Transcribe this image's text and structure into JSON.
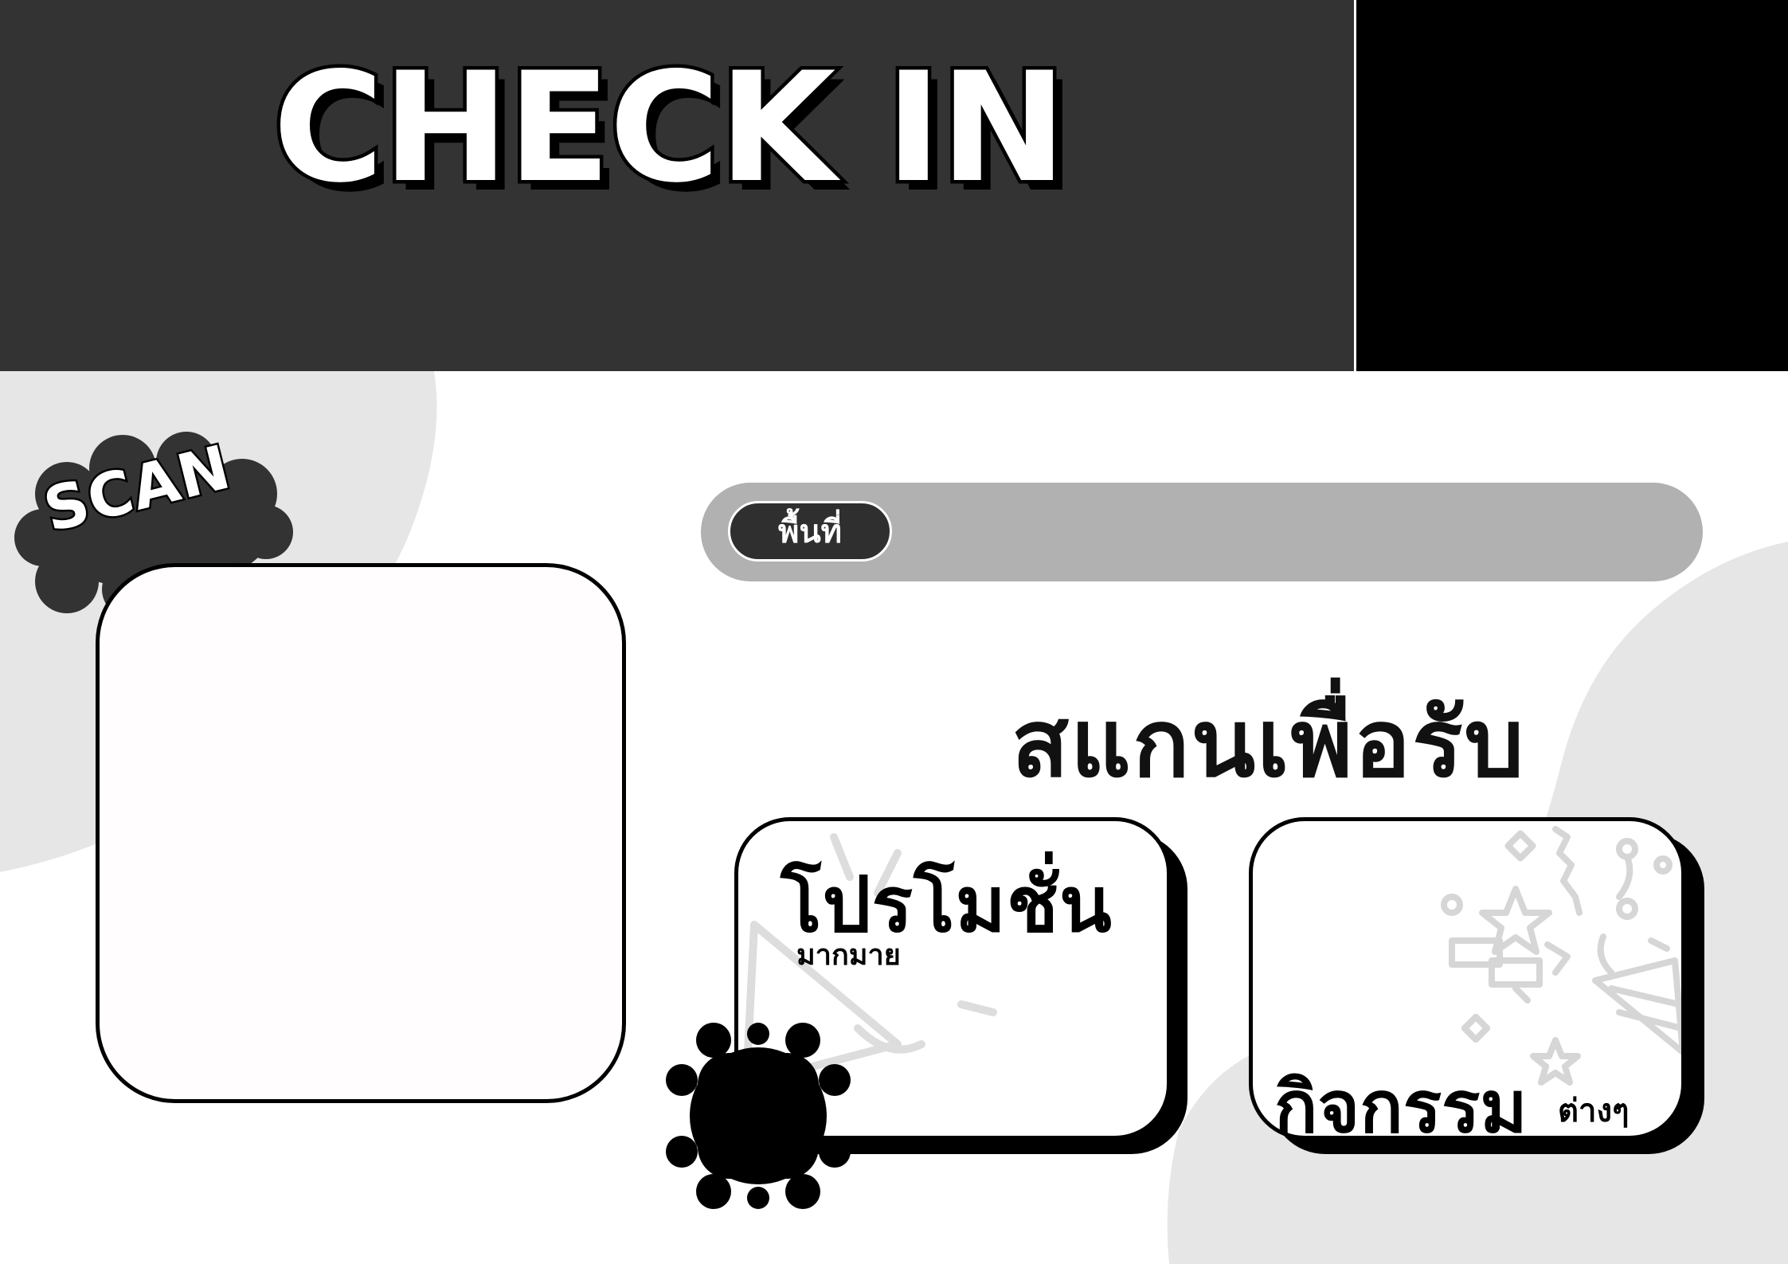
{
  "header": {
    "title": "CHECK IN"
  },
  "scan_label": "SCAN",
  "location": {
    "label": "พื้นที่"
  },
  "heading": "สแกนเพื่อรับ",
  "promo_card": {
    "title": "โปรโมชั่น",
    "subtitle": "มากมาย"
  },
  "activity_card": {
    "title": "กิจกรรม",
    "subtitle": "ต่างๆ"
  },
  "colors": {
    "header_bg": "#333333",
    "header_block": "#000000",
    "location_bar": "#b1b1b1",
    "location_pill": "#2f2f2f",
    "blob": "#e6e6e6"
  },
  "icons": [
    "party-popper-icon",
    "confetti-icon",
    "party-hat-icon",
    "scalloped-badge"
  ]
}
